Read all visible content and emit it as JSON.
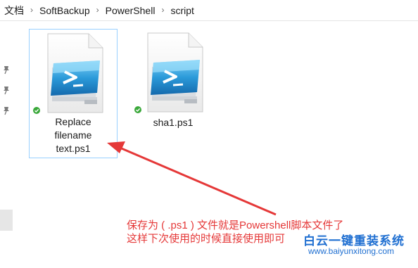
{
  "breadcrumb": {
    "items": [
      "文档",
      "SoftBackup",
      "PowerShell",
      "script"
    ],
    "separator": "›"
  },
  "files": [
    {
      "name_lines": [
        "Replace",
        "filename",
        "text.ps1"
      ],
      "selected": true,
      "status": "synced-check-icon"
    },
    {
      "name_lines": [
        "sha1.ps1"
      ],
      "selected": false,
      "status": "synced-check-icon"
    }
  ],
  "annotation": {
    "line1": "保存为 ( .ps1 ) 文件就是Powershell脚本文件了",
    "line2": "这样下次使用的时候直接使用即可"
  },
  "watermark": {
    "name": "白云一键重装系统",
    "url": "www.baiyunxitong.com"
  },
  "colors": {
    "accent": "#99d1ff",
    "annotation": "#e53838",
    "watermark": "#1f6fd1",
    "check": "#3aa83a"
  }
}
